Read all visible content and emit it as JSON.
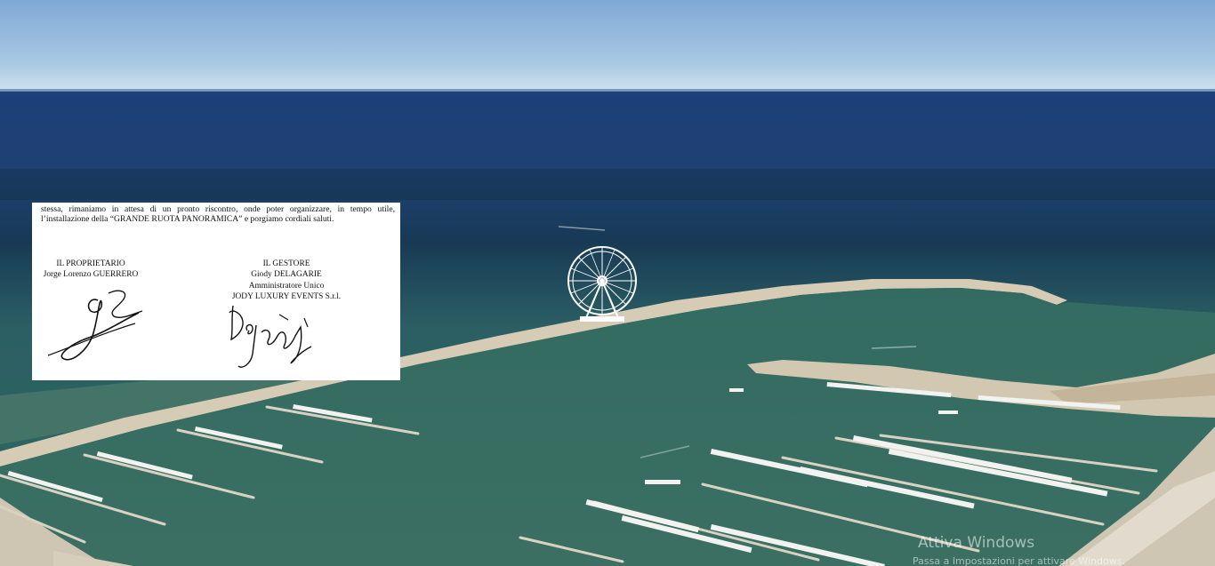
{
  "document_excerpt": {
    "paragraph_line1": "stessa, rimaniamo in attesa di un pronto riscontro, onde poter organizzare, in tempo utile,",
    "paragraph_line2": "l’installazione della “GRANDE RUOTA PANORAMICA” e porgiamo cordiali saluti.",
    "owner": {
      "role": "IL PROPRIETARIO",
      "name": "Jorge Lorenzo GUERRERO"
    },
    "manager": {
      "role": "IL GESTORE",
      "name": "Giody DELAGARIE",
      "title": "Amministratore Unico",
      "company": "JODY LUXURY EVENTS S.r.l."
    }
  },
  "watermark": {
    "line1": "Attiva Windows",
    "line2": "Passa a Impostazioni per attivare Windows."
  },
  "colors": {
    "sky_top": "#7fa9d6",
    "sky_horizon": "#cfe2ee",
    "sea_far": "#1d3f7a",
    "sea_near": "#2f675f",
    "breakwater": "#d8cdb8"
  }
}
